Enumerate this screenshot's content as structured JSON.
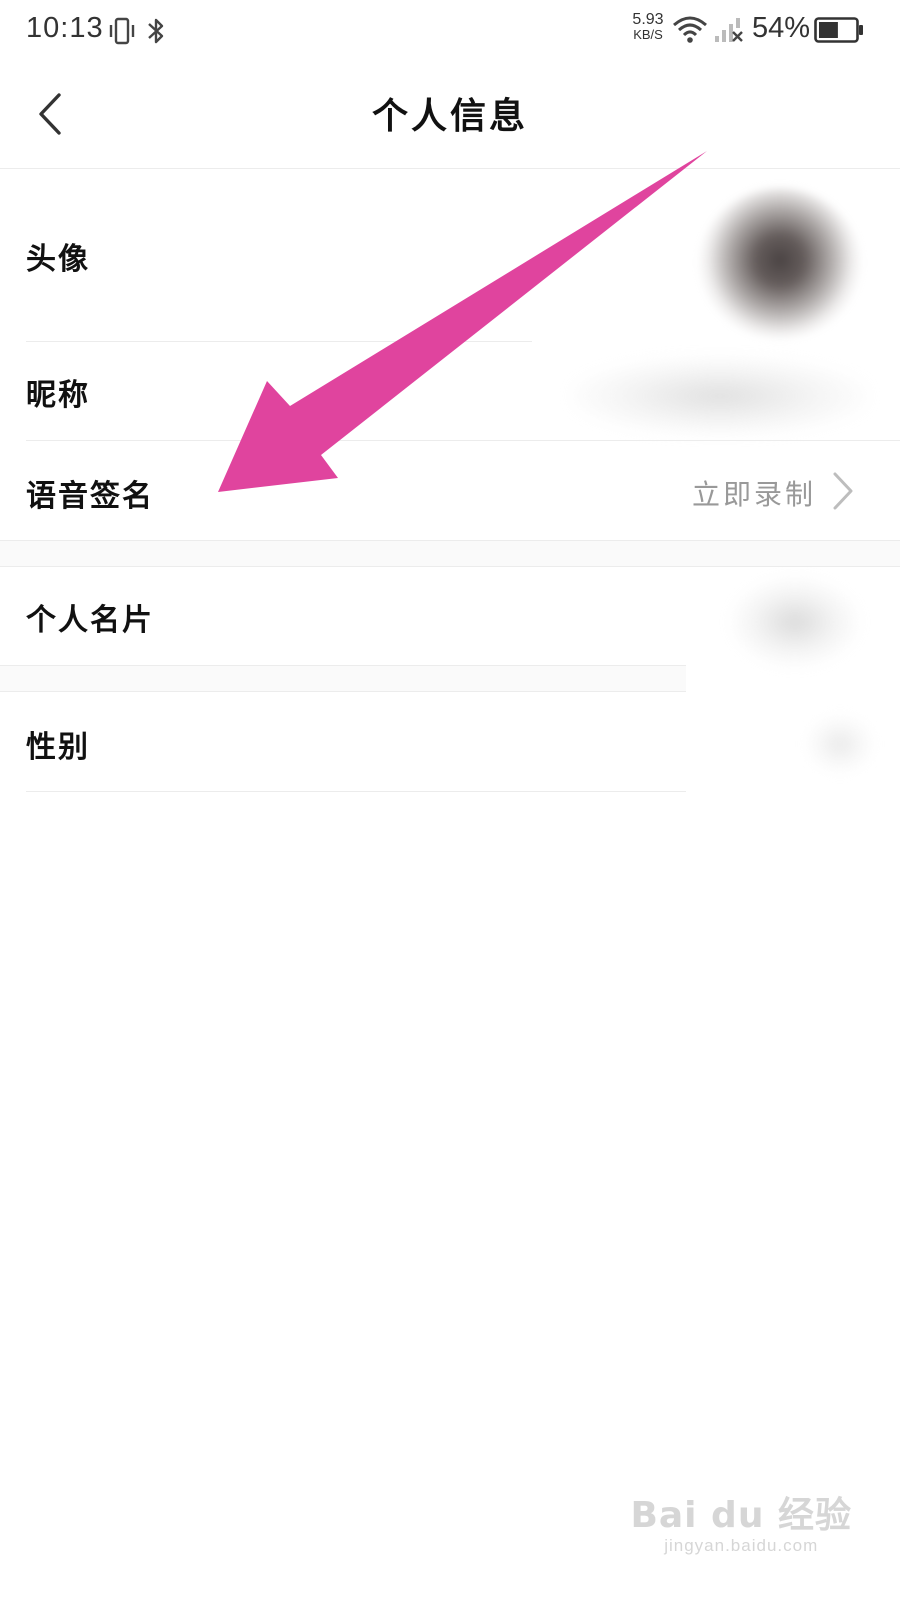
{
  "status_bar": {
    "time": "10:13",
    "net_speed_value": "5.93",
    "net_speed_unit": "KB/S",
    "battery_percent": "54%",
    "battery_level": 0.54
  },
  "nav": {
    "title": "个人信息"
  },
  "rows": [
    {
      "label": "头像",
      "value": ""
    },
    {
      "label": "昵称",
      "value": ""
    },
    {
      "label": "语音签名",
      "value": "立即录制"
    },
    {
      "label": "个人名片",
      "value": ""
    },
    {
      "label": "性别",
      "value": ""
    }
  ],
  "watermark": {
    "logo": "Bai du 经验",
    "url": "jingyan.baidu.com"
  },
  "colors": {
    "annotation_arrow": "#e0449e",
    "value_text": "#999999",
    "divider": "#ececec"
  }
}
